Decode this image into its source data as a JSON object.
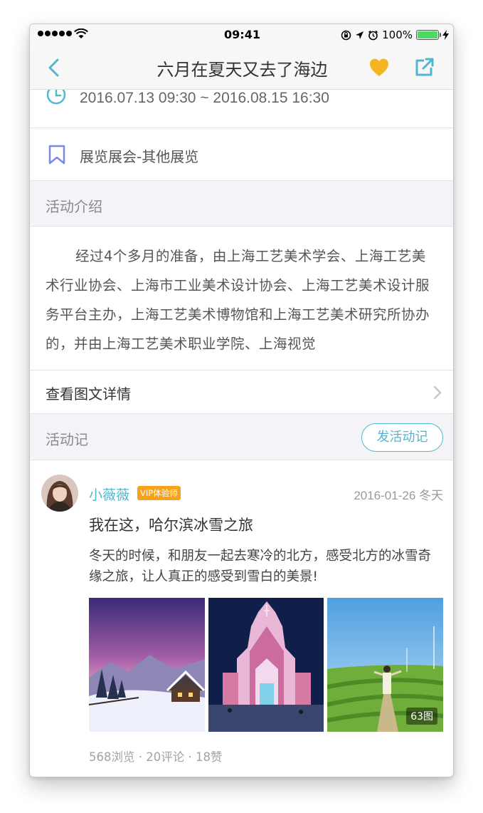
{
  "status_bar": {
    "time": "09:41",
    "battery_text": "100%",
    "battery_level": 1.0
  },
  "nav": {
    "title": "六月在夏天又去了海边",
    "accent_color": "#4fb8cf",
    "favorite_color": "#f5b520"
  },
  "event": {
    "time_range": "2016.07.13 09:30 ~ 2016.08.15 16:30",
    "category": "展览展会-其他展览"
  },
  "intro_section": {
    "title": "活动介绍",
    "body": "经过4个多月的准备，由上海工艺美术学会、上海工艺美术行业协会、上海市工业美术设计协会、上海工艺美术设计服务平台主办，上海工艺美术博物馆和上海工艺美术研究所协办的，并由上海工艺美术职业学院、上海视觉"
  },
  "detail_link": {
    "label": "查看图文详情"
  },
  "notes_section": {
    "title": "活动记",
    "post_button": "发活动记"
  },
  "post": {
    "username": "小薇薇",
    "badge": "VIP体验师",
    "date": "2016-01-26 冬天",
    "title": "我在这，哈尔滨冰雪之旅",
    "text": "冬天的时候，和朋友一起去寒冷的北方，感受北方的冰雪奇缘之旅，让人真正的感受到雪白的美景!",
    "photo_count": "63图",
    "stats": "568浏览 · 20评论 · 18赞"
  }
}
